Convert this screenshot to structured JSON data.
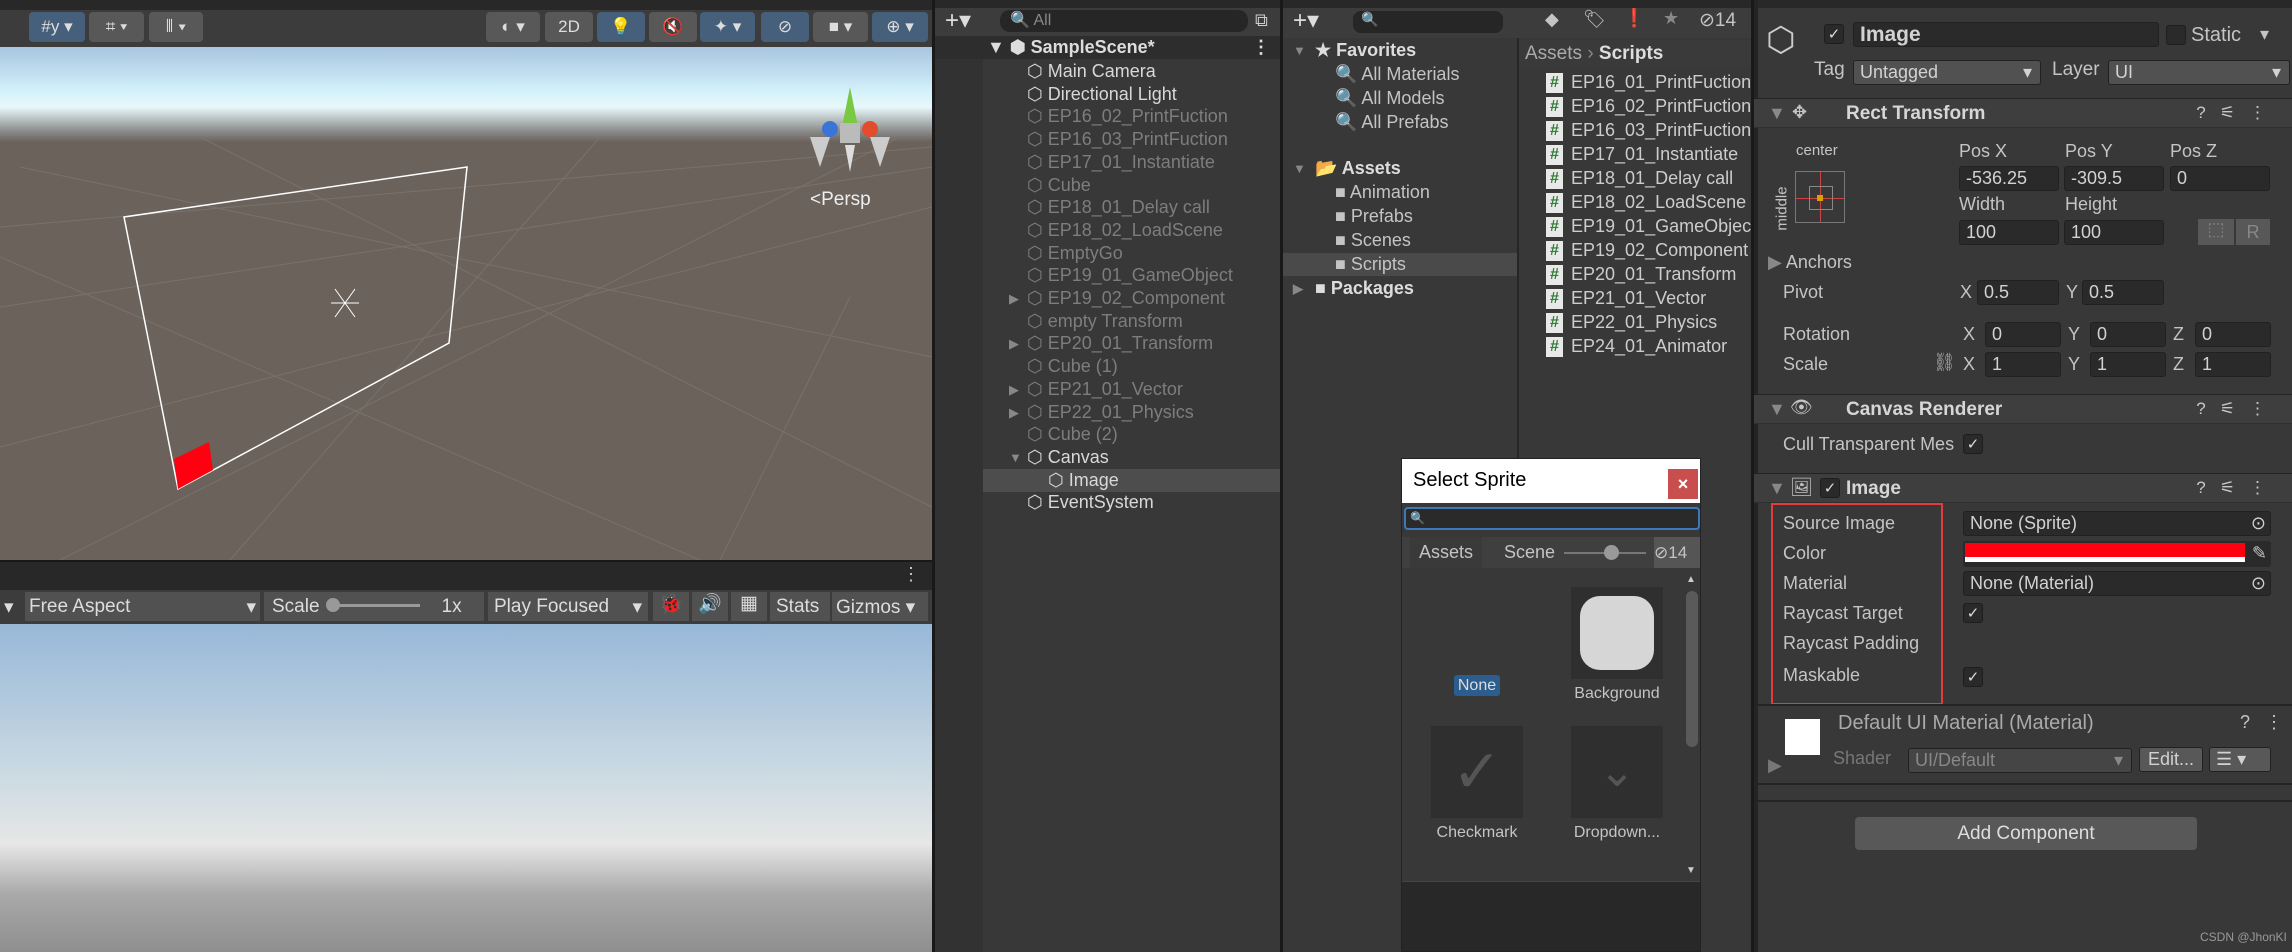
{
  "scene_toolbar": {
    "btn_2d": "2D"
  },
  "scene_view": {
    "persp_label": "Persp",
    "selected_color": "#ff0010"
  },
  "game_toolbar": {
    "aspect": "Free Aspect",
    "scale_label": "Scale",
    "scale_value": "1x",
    "play_mode": "Play Focused",
    "stats": "Stats",
    "gizmos": "Gizmos"
  },
  "hierarchy": {
    "search_placeholder": "All",
    "scene": "SampleScene*",
    "items": [
      {
        "label": "Main Camera",
        "depth": 1,
        "active": true,
        "expandable": false
      },
      {
        "label": "Directional Light",
        "depth": 1,
        "active": true,
        "expandable": false
      },
      {
        "label": "EP16_02_PrintFuction",
        "depth": 1,
        "active": false,
        "expandable": false
      },
      {
        "label": "EP16_03_PrintFuction",
        "depth": 1,
        "active": false,
        "expandable": false
      },
      {
        "label": "EP17_01_Instantiate",
        "depth": 1,
        "active": false,
        "expandable": false
      },
      {
        "label": "Cube",
        "depth": 1,
        "active": false,
        "expandable": false
      },
      {
        "label": "EP18_01_Delay call",
        "depth": 1,
        "active": false,
        "expandable": false
      },
      {
        "label": "EP18_02_LoadScene",
        "depth": 1,
        "active": false,
        "expandable": false
      },
      {
        "label": "EmptyGo",
        "depth": 1,
        "active": false,
        "expandable": false
      },
      {
        "label": "EP19_01_GameObject",
        "depth": 1,
        "active": false,
        "expandable": false
      },
      {
        "label": "EP19_02_Component",
        "depth": 1,
        "active": false,
        "expandable": true
      },
      {
        "label": "empty Transform",
        "depth": 1,
        "active": false,
        "expandable": false
      },
      {
        "label": "EP20_01_Transform",
        "depth": 1,
        "active": false,
        "expandable": true
      },
      {
        "label": "Cube (1)",
        "depth": 1,
        "active": false,
        "expandable": false
      },
      {
        "label": "EP21_01_Vector",
        "depth": 1,
        "active": false,
        "expandable": true
      },
      {
        "label": "EP22_01_Physics",
        "depth": 1,
        "active": false,
        "expandable": true
      },
      {
        "label": "Cube (2)",
        "depth": 1,
        "active": false,
        "expandable": false
      },
      {
        "label": "Canvas",
        "depth": 1,
        "active": true,
        "expandable": true,
        "expanded": true
      },
      {
        "label": "Image",
        "depth": 2,
        "active": true,
        "expandable": false,
        "selected": true
      },
      {
        "label": "EventSystem",
        "depth": 1,
        "active": true,
        "expandable": false
      }
    ]
  },
  "project": {
    "hidden_count": "14",
    "favorites": "Favorites",
    "favorite_items": [
      "All Materials",
      "All Models",
      "All Prefabs"
    ],
    "assets": "Assets",
    "asset_folders": [
      "Animation",
      "Prefabs",
      "Scenes",
      "Scripts"
    ],
    "packages": "Packages",
    "breadcrumb": [
      "Assets",
      "Scripts"
    ],
    "files": [
      "EP16_01_PrintFuction",
      "EP16_02_PrintFuction",
      "EP16_03_PrintFuction",
      "EP17_01_Instantiate",
      "EP18_01_Delay call",
      "EP18_02_LoadScene",
      "EP19_01_GameObject",
      "EP19_02_Component",
      "EP20_01_Transform",
      "EP21_01_Vector",
      "EP22_01_Physics",
      "EP24_01_Animator"
    ]
  },
  "select_sprite": {
    "title": "Select Sprite",
    "tabs": [
      "Assets",
      "Scene"
    ],
    "hidden_count": "14",
    "items": [
      "None",
      "Background",
      "Checkmark",
      "Dropdown..."
    ]
  },
  "inspector": {
    "name": "Image",
    "static": "Static",
    "tag_label": "Tag",
    "tag": "Untagged",
    "layer_label": "Layer",
    "layer": "UI",
    "rect": {
      "title": "Rect Transform",
      "anchor_h": "center",
      "anchor_v": "middle",
      "posx_l": "Pos X",
      "posy_l": "Pos Y",
      "posz_l": "Pos Z",
      "posx": "-536.25",
      "posy": "-309.5",
      "posz": "0",
      "width_l": "Width",
      "height_l": "Height",
      "width": "100",
      "height": "100",
      "r_btn": "R",
      "anchors": "Anchors",
      "pivot": "Pivot",
      "pivot_x": "0.5",
      "pivot_y": "0.5",
      "rotation": "Rotation",
      "rot": [
        "0",
        "0",
        "0"
      ],
      "scale": "Scale",
      "scl": [
        "1",
        "1",
        "1"
      ],
      "x": "X",
      "y": "Y",
      "z": "Z"
    },
    "canvas_renderer": {
      "title": "Canvas Renderer",
      "cull": "Cull Transparent Mes"
    },
    "image": {
      "title": "Image",
      "source_l": "Source Image",
      "source": "None (Sprite)",
      "color_l": "Color",
      "color": "#ff0010",
      "material_l": "Material",
      "material": "None (Material)",
      "raycast_l": "Raycast Target",
      "padding_l": "Raycast Padding",
      "maskable_l": "Maskable"
    },
    "material": {
      "title": "Default UI Material (Material)",
      "shader_l": "Shader",
      "shader": "UI/Default",
      "edit": "Edit..."
    },
    "add_component": "Add Component"
  },
  "watermark": "CSDN @JhonKI"
}
